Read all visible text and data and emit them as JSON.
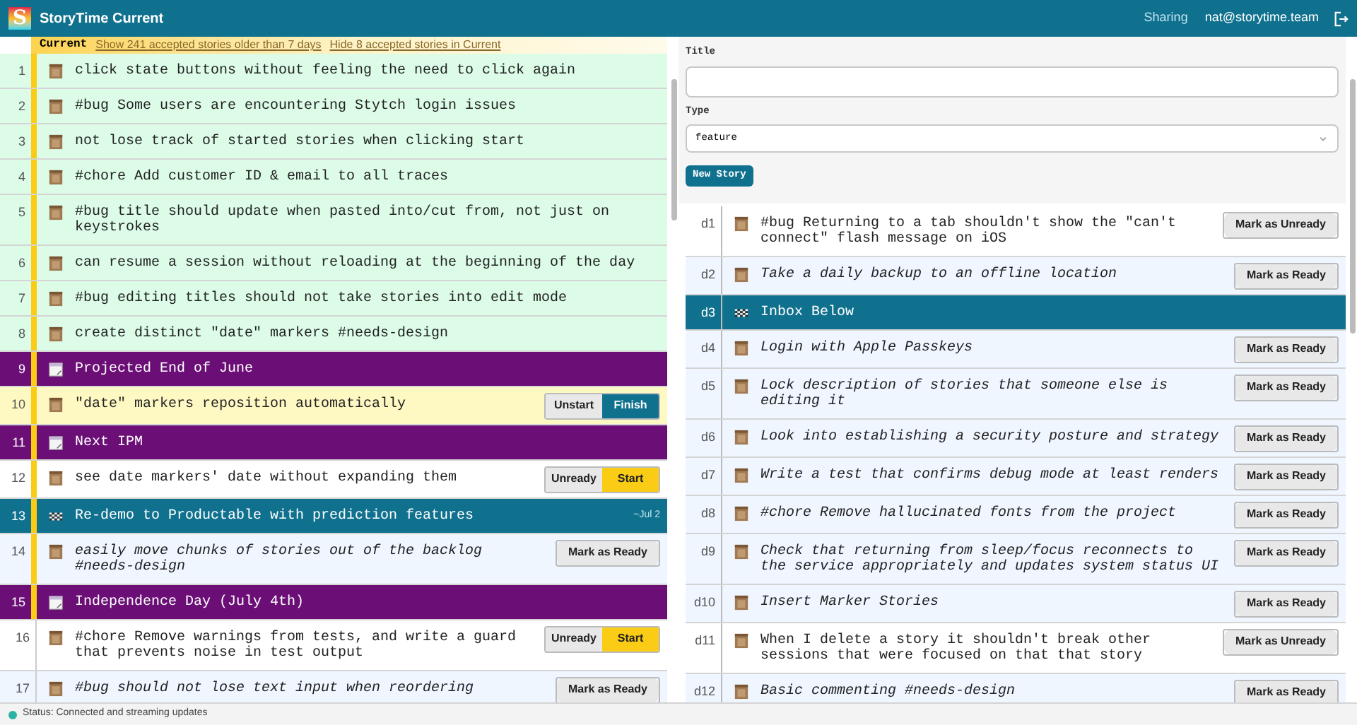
{
  "header": {
    "logo": "S",
    "title": "StoryTime Current",
    "sharing": "Sharing",
    "user": "nat@storytime.team"
  },
  "banner": {
    "label": "Current",
    "links": [
      "Show 241 accepted stories older than 7 days",
      "Hide 8 accepted stories in Current"
    ]
  },
  "stories": [
    {
      "number": "1",
      "kind": "accepted",
      "in_current": true,
      "title": "click state buttons without feeling the need to click again"
    },
    {
      "number": "2",
      "kind": "accepted",
      "in_current": true,
      "title": "#bug Some users are encountering Stytch login issues"
    },
    {
      "number": "3",
      "kind": "accepted",
      "in_current": true,
      "title": "not lose track of started stories when clicking start"
    },
    {
      "number": "4",
      "kind": "accepted",
      "in_current": true,
      "title": "#chore Add customer ID & email to all traces"
    },
    {
      "number": "5",
      "kind": "accepted",
      "in_current": true,
      "title": "#bug title should update when pasted into/cut from, not just on keystrokes"
    },
    {
      "number": "6",
      "kind": "accepted",
      "in_current": true,
      "title": "can resume a session without reloading at the beginning of the day"
    },
    {
      "number": "7",
      "kind": "accepted",
      "in_current": true,
      "title": "#bug editing titles should not take stories into edit mode"
    },
    {
      "number": "8",
      "kind": "accepted",
      "in_current": true,
      "title": "create distinct \"date\" markers #needs-design"
    },
    {
      "number": "9",
      "kind": "marker",
      "in_current": true,
      "title": "Projected End of June"
    },
    {
      "number": "10",
      "kind": "started",
      "in_current": true,
      "title": "\"date\" markers reposition automatically",
      "buttons": [
        {
          "label": "Unstart",
          "kind": "plain"
        },
        {
          "label": "Finish",
          "kind": "finish"
        }
      ]
    },
    {
      "number": "11",
      "kind": "marker",
      "in_current": true,
      "title": "Next IPM"
    },
    {
      "number": "12",
      "kind": "ready",
      "in_current": true,
      "title": "see date markers' date without expanding them",
      "buttons": [
        {
          "label": "Unready",
          "kind": "plain"
        },
        {
          "label": "Start",
          "kind": "start"
        }
      ]
    },
    {
      "number": "13",
      "kind": "milestone",
      "in_current": true,
      "title": "Re-demo to Productable with prediction features",
      "date": "~Jul 2"
    },
    {
      "number": "14",
      "kind": "unready",
      "in_current": true,
      "title": "easily move chunks of stories out of the backlog #needs-design",
      "buttons": [
        {
          "label": "Mark as Ready",
          "kind": "wide"
        }
      ]
    },
    {
      "number": "15",
      "kind": "marker",
      "in_current": true,
      "title": "Independence Day (July 4th)"
    },
    {
      "number": "16",
      "kind": "ready",
      "in_current": false,
      "title": "#chore Remove warnings from tests, and write a guard that prevents noise in test output",
      "buttons": [
        {
          "label": "Unready",
          "kind": "plain"
        },
        {
          "label": "Start",
          "kind": "start"
        }
      ]
    },
    {
      "number": "17",
      "kind": "unready",
      "in_current": false,
      "title": "#bug should not lose text input when reordering",
      "buttons": [
        {
          "label": "Mark as Ready",
          "kind": "wide"
        }
      ]
    }
  ],
  "form": {
    "title_label": "Title",
    "type_label": "Type",
    "type_value": "feature",
    "submit": "New Story"
  },
  "drafts": [
    {
      "number": "d1",
      "kind": "ready",
      "title": "#bug Returning to a tab shouldn't show the \"can't connect\" flash message on iOS",
      "buttons": [
        {
          "label": "Mark as Unready",
          "kind": "wide"
        }
      ]
    },
    {
      "number": "d2",
      "kind": "unready",
      "title": "Take a daily backup to an offline location",
      "buttons": [
        {
          "label": "Mark as Ready",
          "kind": "wide"
        }
      ]
    },
    {
      "number": "d3",
      "kind": "milestone",
      "title": "Inbox Below"
    },
    {
      "number": "d4",
      "kind": "unready",
      "title": "Login with Apple Passkeys",
      "buttons": [
        {
          "label": "Mark as Ready",
          "kind": "wide"
        }
      ]
    },
    {
      "number": "d5",
      "kind": "unready",
      "title": "Lock description of stories that someone else is editing it",
      "buttons": [
        {
          "label": "Mark as Ready",
          "kind": "wide"
        }
      ]
    },
    {
      "number": "d6",
      "kind": "unready",
      "title": "Look into establishing a security posture and strategy",
      "buttons": [
        {
          "label": "Mark as Ready",
          "kind": "wide"
        }
      ]
    },
    {
      "number": "d7",
      "kind": "unready",
      "title": "Write a test that confirms debug mode at least renders",
      "buttons": [
        {
          "label": "Mark as Ready",
          "kind": "wide"
        }
      ]
    },
    {
      "number": "d8",
      "kind": "unready",
      "title": "#chore Remove hallucinated fonts from the project",
      "buttons": [
        {
          "label": "Mark as Ready",
          "kind": "wide"
        }
      ]
    },
    {
      "number": "d9",
      "kind": "unready",
      "title": "Check that returning from sleep/focus reconnects to the service appropriately and updates system status UI",
      "buttons": [
        {
          "label": "Mark as Ready",
          "kind": "wide"
        }
      ]
    },
    {
      "number": "d10",
      "kind": "unready",
      "title": "Insert Marker Stories",
      "buttons": [
        {
          "label": "Mark as Ready",
          "kind": "wide"
        }
      ]
    },
    {
      "number": "d11",
      "kind": "ready",
      "title": "When I delete a story it shouldn't break other sessions that were focused on that that story",
      "buttons": [
        {
          "label": "Mark as Unready",
          "kind": "wide"
        }
      ]
    },
    {
      "number": "d12",
      "kind": "unready",
      "title": "Basic commenting #needs-design",
      "buttons": [
        {
          "label": "Mark as Ready",
          "kind": "wide"
        }
      ]
    }
  ],
  "status": {
    "connected": true,
    "text": "Status: Connected and streaming updates"
  }
}
